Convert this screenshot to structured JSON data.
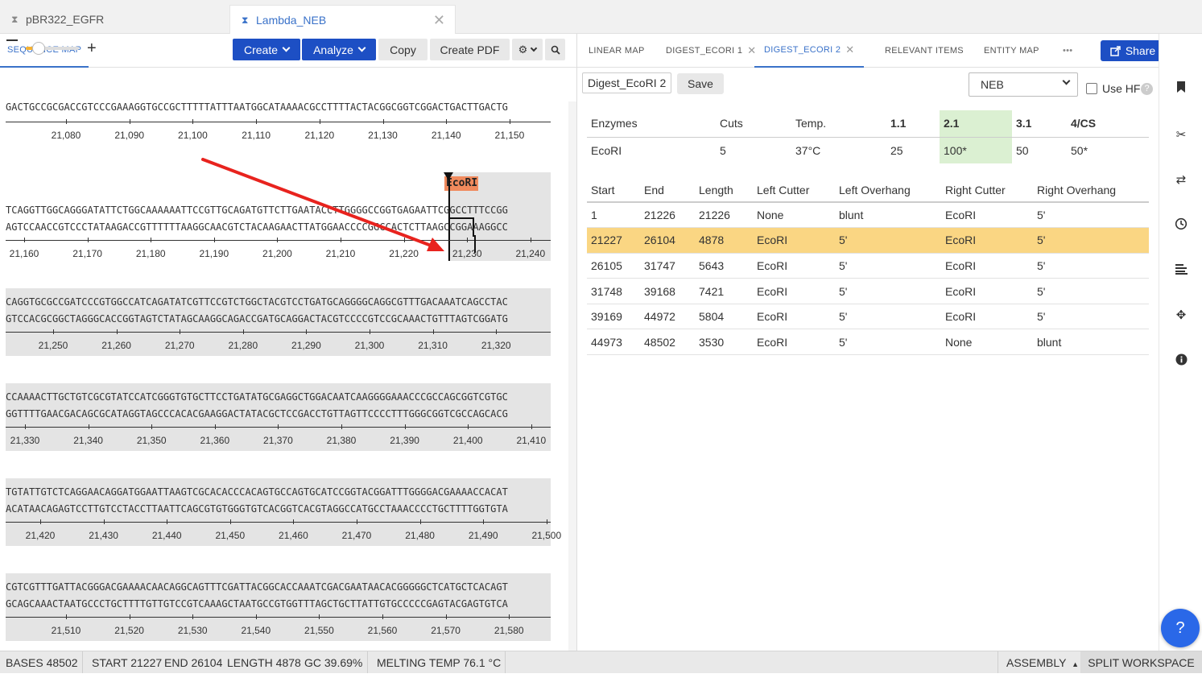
{
  "file_tabs": [
    {
      "label": "pBR322_EGFR"
    },
    {
      "label": "Lambda_NEB"
    }
  ],
  "left": {
    "tab": "SEQUENCE MAP",
    "toolbar": {
      "create": "Create",
      "analyze": "Analyze",
      "copy": "Copy",
      "create_pdf": "Create PDF"
    },
    "top_seq": "GACTGCCGCGACCGTCCCGAAAGGTGCCGCTTTTTATTTAATGGCATAAAACGCCTTTTACTACGGCGGTCGGACTGACTTGACTG",
    "top_ticks": [
      "21,080",
      "21,090",
      "21,100",
      "21,110",
      "21,120",
      "21,130",
      "21,140",
      "21,150"
    ],
    "feature_label": "EcoRI",
    "rows": [
      {
        "top": "TCAGGTTGGCAGGGATATTCTGGCAAAAAATTCCGTTGCAGATGTTCTTGAATACCTTGGGGCCGGTGAGAATTCGGCCTTTCCGG",
        "bottom": "AGTCCAACCGTCCCTATAAGACCGTTTTTTAAGGCAACGTCTACAAGAACTTATGGAACCCCGGCCACTCTTAAGCCGGAAAGGCC",
        "ticks": [
          "21,160",
          "21,170",
          "21,180",
          "21,190",
          "21,200",
          "21,210",
          "21,220",
          "21,230",
          "21,240"
        ]
      },
      {
        "top": "CAGGTGCGCCGATCCCGTGGCCATCAGATATCGTTCCGTCTGGCTACGTCCTGATGCAGGGGCAGGCGTTTGACAAATCAGCCTAC",
        "bottom": "GTCCACGCGGCTAGGGCACCGGTAGTCTATAGCAAGGCAGACCGATGCAGGACTACGTCCCCGTCCGCAAACTGTTTAGTCGGATG",
        "ticks": [
          "21,250",
          "21,260",
          "21,270",
          "21,280",
          "21,290",
          "21,300",
          "21,310",
          "21,320"
        ]
      },
      {
        "top": "CCAAAACTTGCTGTCGCGTATCCATCGGGTGTGCTTCCTGATATGCGAGGCTGGACAATCAAGGGGAAACCCGCCAGCGGTCGTGC",
        "bottom": "GGTTTTGAACGACAGCGCATAGGTAGCCCACACGAAGGACTATACGCTCCGACCTGTTAGTTCCCCTTTGGGCGGTCGCCAGCACG",
        "ticks": [
          "21,330",
          "21,340",
          "21,350",
          "21,360",
          "21,370",
          "21,380",
          "21,390",
          "21,400",
          "21,410"
        ]
      },
      {
        "top": "TGTATTGTCTCAGGAACAGGATGGAATTAAGTCGCACACCCACAGTGCCAGTGCATCCGGTACGGATTTGGGGACGAAAACCACAT",
        "bottom": "ACATAACAGAGTCCTTGTCCTACCTTAATTCAGCGTGTGGGTGTCACGGTCACGTAGGCCATGCCTAAACCCCTGCTTTTGGTGTA",
        "ticks": [
          "21,420",
          "21,430",
          "21,440",
          "21,450",
          "21,460",
          "21,470",
          "21,480",
          "21,490",
          "21,500"
        ]
      },
      {
        "top": "CGTCGTTTGATTACGGGACGAAAACAACAGGCAGTTTCGATTACGGCACCAAATCGACGAATAACACGGGGGCTCATGCTCACAGT",
        "bottom": "GCAGCAAACTAATGCCCTGCTTTTGTTGTCCGTCAAAGCTAATGCCGTGGTTTAGCTGCTTATTGTGCCCCCGAGTACGAGTGTCA",
        "ticks": [
          "21,510",
          "21,520",
          "21,530",
          "21,540",
          "21,550",
          "21,560",
          "21,570",
          "21,580"
        ]
      }
    ]
  },
  "right": {
    "tabs": [
      {
        "label": "LINEAR MAP"
      },
      {
        "label": "DIGEST_ECORI 1"
      },
      {
        "label": "DIGEST_ECORI 2"
      },
      {
        "label": "RELEVANT ITEMS"
      },
      {
        "label": "ENTITY MAP"
      },
      {
        "label": "•••"
      }
    ],
    "share": "Share",
    "digest_name": "Digest_EcoRI 2",
    "save": "Save",
    "buffer_select": "NEB",
    "use_hf": "Use HF",
    "help_q": "?",
    "enzyme_headers": [
      "Enzymes",
      "Cuts",
      "Temp.",
      "1.1",
      "2.1",
      "3.1",
      "4/CS"
    ],
    "enzyme_rows": [
      [
        "EcoRI",
        "5",
        "37°C",
        "25",
        "100*",
        "50",
        "50*"
      ]
    ],
    "frag_headers": [
      "Start",
      "End",
      "Length",
      "Left Cutter",
      "Left Overhang",
      "Right Cutter",
      "Right Overhang"
    ],
    "frag_rows": [
      [
        "1",
        "21226",
        "21226",
        "None",
        "blunt",
        "EcoRI",
        "5'"
      ],
      [
        "21227",
        "26104",
        "4878",
        "EcoRI",
        "5'",
        "EcoRI",
        "5'"
      ],
      [
        "26105",
        "31747",
        "5643",
        "EcoRI",
        "5'",
        "EcoRI",
        "5'"
      ],
      [
        "31748",
        "39168",
        "7421",
        "EcoRI",
        "5'",
        "EcoRI",
        "5'"
      ],
      [
        "39169",
        "44972",
        "5804",
        "EcoRI",
        "5'",
        "EcoRI",
        "5'"
      ],
      [
        "44973",
        "48502",
        "3530",
        "EcoRI",
        "5'",
        "None",
        "blunt"
      ]
    ],
    "selected_row": 1
  },
  "rail_icons": [
    "bookmark-icon",
    "scissors-icon",
    "swap-icon",
    "history-icon",
    "align-icon",
    "crosshair-icon",
    "info-icon"
  ],
  "help_fab": "?",
  "status": {
    "bases": "BASES 48502",
    "start": "START 21227",
    "end": "END 26104",
    "length": "LENGTH 4878",
    "gc": "GC 39.69%",
    "melting": "MELTING TEMP 76.1 °C",
    "assembly": "ASSEMBLY",
    "split": "SPLIT WORKSPACE"
  },
  "colors": {
    "accent": "#1d4fc4",
    "tab_active": "#3a72c9",
    "selected_row": "#fad683",
    "buffer_highlight": "#dbf0d2",
    "feature": "#f08a5d",
    "arrow": "#e8231e"
  }
}
